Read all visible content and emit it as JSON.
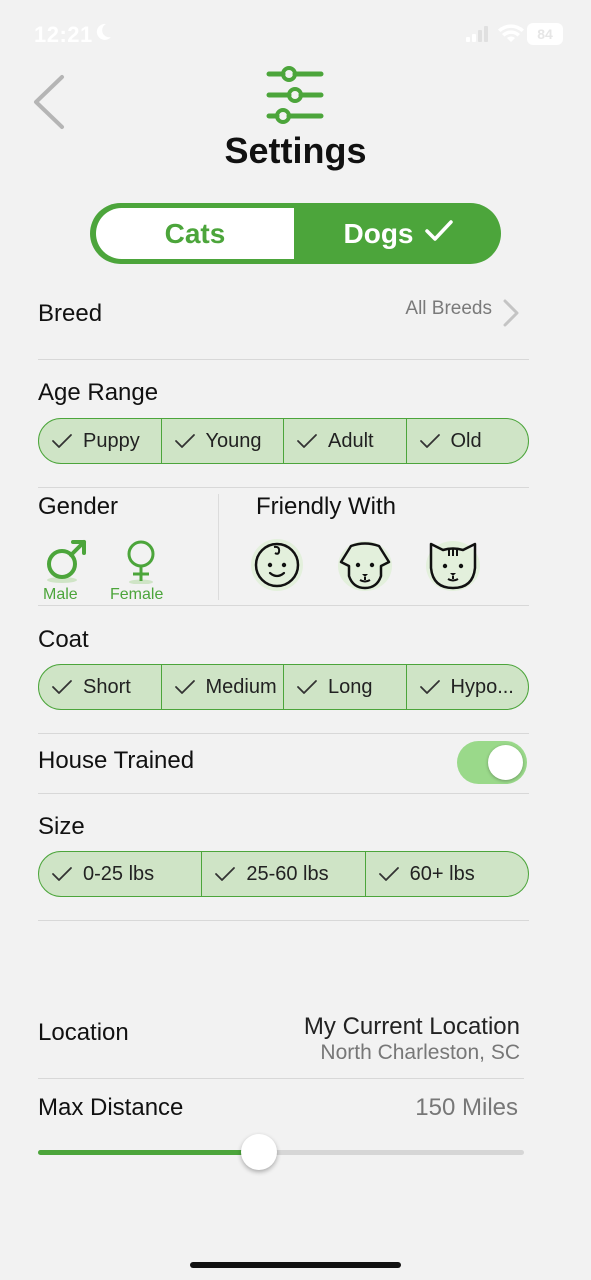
{
  "status_bar": {
    "time": "12:21",
    "battery": "84"
  },
  "header": {
    "title": "Settings"
  },
  "species_toggle": {
    "cats_label": "Cats",
    "dogs_label": "Dogs",
    "selected": "Dogs"
  },
  "breed": {
    "label": "Breed",
    "value": "All Breeds"
  },
  "age_range": {
    "label": "Age Range",
    "options": [
      "Puppy",
      "Young",
      "Adult",
      "Old"
    ]
  },
  "gender": {
    "label": "Gender",
    "male_label": "Male",
    "female_label": "Female"
  },
  "friendly_with": {
    "label": "Friendly With",
    "icons": [
      "child-face-icon",
      "dog-face-icon",
      "cat-face-icon"
    ]
  },
  "coat": {
    "label": "Coat",
    "options": [
      "Short",
      "Medium",
      "Long",
      "Hypo..."
    ]
  },
  "house_trained": {
    "label": "House Trained",
    "enabled": true
  },
  "size": {
    "label": "Size",
    "options": [
      "0-25 lbs",
      "25-60 lbs",
      "60+ lbs"
    ]
  },
  "location": {
    "label": "Location",
    "value": "My Current Location",
    "sublabel": "North Charleston, SC"
  },
  "max_distance": {
    "label": "Max Distance",
    "value": "150 Miles",
    "slider_fraction": 0.455
  },
  "colors": {
    "accent": "#4ca53b",
    "pill_fill": "#cfe4c6",
    "background": "#f2f2f2",
    "toggle_on": "#9ad98a"
  }
}
